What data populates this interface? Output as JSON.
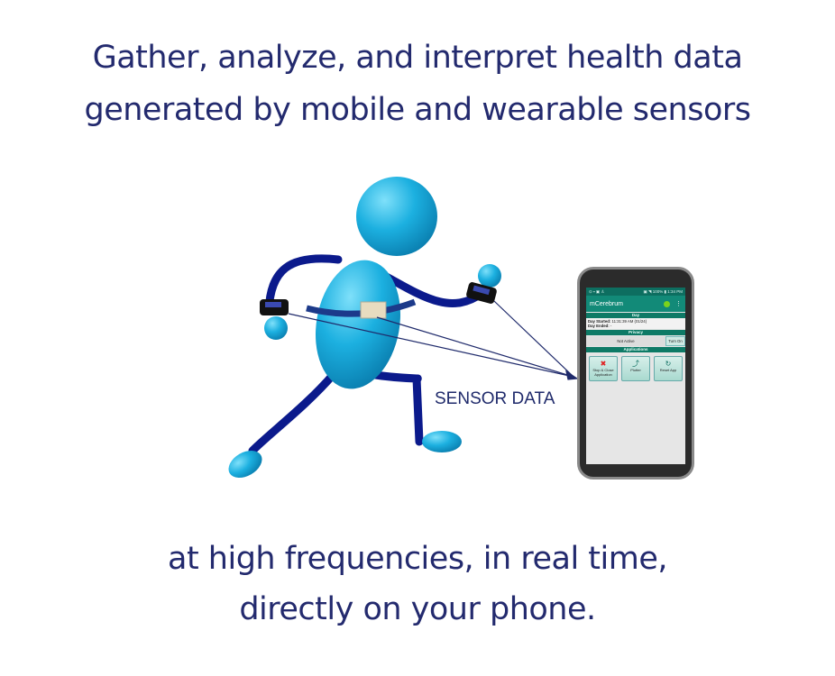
{
  "headline": {
    "line1": "Gather, analyze, and interpret health data",
    "line2": "generated by mobile and wearable sensors"
  },
  "sensor_label": "SENSOR DATA",
  "footer": {
    "line1": "at high frequencies, in real time,",
    "line2": "directly on your phone."
  },
  "phone": {
    "status_left": "⊙ ▪ ▣ ♙",
    "status_right": "▣ ◥ 100% ▮ 1:34 PM",
    "app_title": "mCerebrum",
    "menu_icon": "⋮",
    "day_header": "Day",
    "day_started_label": "Day Started:",
    "day_started_value": "11:31:39 AM (01/24)",
    "day_ended_label": "Day Ended:",
    "day_ended_value": "-",
    "privacy_header": "Privacy",
    "privacy_status": "Not Active",
    "turn_on": "Turn On",
    "applications_header": "Applications",
    "apps": [
      {
        "icon": "✖",
        "label": "Stop & Close Application"
      },
      {
        "icon": "⤴",
        "label": "Plotter"
      },
      {
        "icon": "↻",
        "label": "Reset App"
      }
    ]
  },
  "colors": {
    "text": "#232a6e",
    "figure": "#1fa9d8",
    "limbs": "#0b1a8c",
    "teal": "#128a78"
  }
}
